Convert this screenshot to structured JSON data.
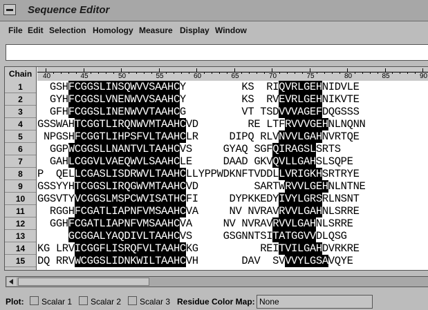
{
  "window": {
    "title": "Sequence Editor"
  },
  "menubar": [
    "File",
    "Edit",
    "Selection",
    "Homology",
    "Measure",
    "Display",
    "Window"
  ],
  "command_input": {
    "value": ""
  },
  "sequence_panel": {
    "chain_header": "Chain",
    "ruler_labels": [
      "40",
      "45",
      "50",
      "55",
      "60",
      "65",
      "70",
      "75",
      "80",
      "85",
      "90"
    ],
    "rows": [
      {
        "chain": "1",
        "seq": [
          {
            "t": "  GSH"
          },
          {
            "t": "FCGGSLINSQWVVSAAHC",
            "h": true
          },
          {
            "t": "Y         KS  RI"
          },
          {
            "t": "QVRLGEH",
            "h": true
          },
          {
            "t": "NIDVLE"
          }
        ]
      },
      {
        "chain": "2",
        "seq": [
          {
            "t": "  GYH"
          },
          {
            "t": "FCGGSLVNENWVVSAAHC",
            "h": true
          },
          {
            "t": "Y         KS  RV"
          },
          {
            "t": "EVRLGEH",
            "h": true
          },
          {
            "t": "NIKVTE"
          }
        ]
      },
      {
        "chain": "3",
        "seq": [
          {
            "t": "  GFH"
          },
          {
            "t": "FCGGSLINENWVVTAAHC",
            "h": true
          },
          {
            "t": "G         VT TSD"
          },
          {
            "t": "VVVAGEF",
            "h": true
          },
          {
            "t": "DQGSSS"
          }
        ]
      },
      {
        "chain": "4",
        "seq": [
          {
            "t": "GSSWAH"
          },
          {
            "t": "TCGGTLIRQNWVMTAAHC",
            "h": true
          },
          {
            "t": "VD        RE LTF"
          },
          {
            "t": "RVVVGEH",
            "h": true
          },
          {
            "t": "NLNQNN"
          }
        ]
      },
      {
        "chain": "5",
        "seq": [
          {
            "t": " NPGSH"
          },
          {
            "t": "FCGGTLIHPSFVLTAAHC",
            "h": true
          },
          {
            "t": "LR     DIPQ RLV"
          },
          {
            "t": "NVVLGAH",
            "h": true
          },
          {
            "t": "NVRTQE"
          }
        ]
      },
      {
        "chain": "6",
        "seq": [
          {
            "t": "  GGP"
          },
          {
            "t": "WCGGSLLNANTVLTAAHC",
            "h": true
          },
          {
            "t": "VS     GYAQ SGF"
          },
          {
            "t": "QIRAGSL",
            "h": true
          },
          {
            "t": "SRTS"
          }
        ]
      },
      {
        "chain": "7",
        "seq": [
          {
            "t": "  GAH"
          },
          {
            "t": "LCGGVLVAEQWVLSAAHC",
            "h": true
          },
          {
            "t": "LE     DAAD GKV"
          },
          {
            "t": "QVLLGAH",
            "h": true
          },
          {
            "t": "SLSQPE"
          }
        ]
      },
      {
        "chain": "8",
        "seq": [
          {
            "t": "P  QEL"
          },
          {
            "t": "LCGASLISDRWVLTAAHC",
            "h": true
          },
          {
            "t": "LLYPPWDKNFTVDDL"
          },
          {
            "t": "LVRIGKH",
            "h": true
          },
          {
            "t": "SRTRYE"
          }
        ]
      },
      {
        "chain": "9",
        "seq": [
          {
            "t": "GSSYYH"
          },
          {
            "t": "TCGGSLIRQGWVMTAAHC",
            "h": true
          },
          {
            "t": "VD         SARTW"
          },
          {
            "t": "RVVLGEH",
            "h": true
          },
          {
            "t": "NLNTNE"
          }
        ]
      },
      {
        "chain": "10",
        "seq": [
          {
            "t": "GGSVTY"
          },
          {
            "t": "VCGGSLMSPCWVISATHC",
            "h": true
          },
          {
            "t": "FI     DYPKKEDY"
          },
          {
            "t": "IVYLGRS",
            "h": true
          },
          {
            "t": "RLNSNT"
          }
        ]
      },
      {
        "chain": "11",
        "seq": [
          {
            "t": "  RGGH"
          },
          {
            "t": "FCGATLIAPNFVMSAAHC",
            "h": true
          },
          {
            "t": "VA     NV NVRAV"
          },
          {
            "t": "RVVLGAH",
            "h": true
          },
          {
            "t": "NLSRRE"
          }
        ]
      },
      {
        "chain": "12",
        "seq": [
          {
            "t": "  GGH"
          },
          {
            "t": "FCGATLIAPNFVMSAAHC",
            "h": true
          },
          {
            "t": "VA     NV NVRAV"
          },
          {
            "t": "RVVLGAH",
            "h": true
          },
          {
            "t": "NLSRRE"
          }
        ]
      },
      {
        "chain": "13",
        "seq": [
          {
            "t": "     "
          },
          {
            "t": "GCGGALYAQDIVLTAAHC",
            "h": true
          },
          {
            "t": "VS     GSGNNTSI"
          },
          {
            "t": "TATGGVV",
            "h": true
          },
          {
            "t": "DLQSG"
          }
        ]
      },
      {
        "chain": "14",
        "seq": [
          {
            "t": "KG LRV"
          },
          {
            "t": "ICGGFLISRQFVLTAAHC",
            "h": true
          },
          {
            "t": "KG          REI"
          },
          {
            "t": "TVILGAH",
            "h": true
          },
          {
            "t": "DVRKRE"
          }
        ]
      },
      {
        "chain": "15",
        "seq": [
          {
            "t": "DQ RRV"
          },
          {
            "t": "WCGGSLIDNKWILTAAHC",
            "h": true
          },
          {
            "t": "VH       DAV  SV"
          },
          {
            "t": "VVYLGSA",
            "h": true
          },
          {
            "t": "VQYE"
          }
        ]
      }
    ]
  },
  "plot_bar": {
    "label": "Plot:",
    "scalars": [
      "Scalar 1",
      "Scalar 2",
      "Scalar 3"
    ],
    "color_map_label": "Residue Color Map:",
    "color_map_value": "None"
  }
}
